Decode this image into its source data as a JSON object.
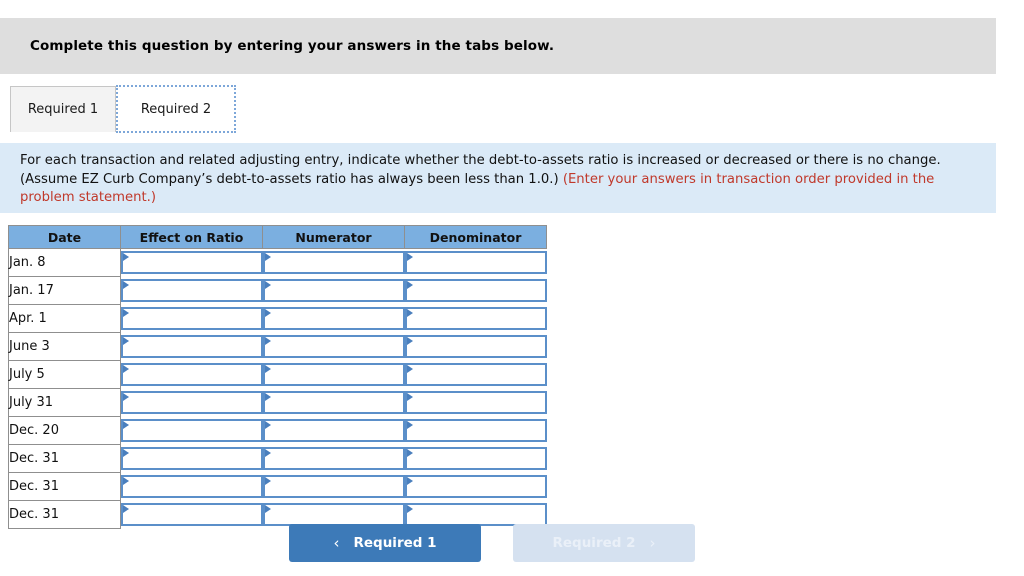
{
  "banner": {
    "text": "Complete this question by entering your answers in the tabs below."
  },
  "tabs": [
    {
      "label": "Required 1",
      "selected": false
    },
    {
      "label": "Required 2",
      "selected": true
    }
  ],
  "instructions": {
    "part1": "For each transaction and related adjusting entry, indicate whether the debt-to-assets ratio is increased or decreased or there is no change. (Assume EZ Curb Company’s debt-to-assets ratio has always been less than 1.0.) ",
    "part2": "(Enter your answers in transaction order provided in the problem statement.)"
  },
  "table": {
    "headers": [
      "Date",
      "Effect on Ratio",
      "Numerator",
      "Denominator"
    ],
    "rows": [
      {
        "date": "Jan. 8",
        "effect": "",
        "numerator": "",
        "denominator": ""
      },
      {
        "date": "Jan. 17",
        "effect": "",
        "numerator": "",
        "denominator": ""
      },
      {
        "date": "Apr. 1",
        "effect": "",
        "numerator": "",
        "denominator": ""
      },
      {
        "date": "June 3",
        "effect": "",
        "numerator": "",
        "denominator": ""
      },
      {
        "date": "July 5",
        "effect": "",
        "numerator": "",
        "denominator": ""
      },
      {
        "date": "July 31",
        "effect": "",
        "numerator": "",
        "denominator": ""
      },
      {
        "date": "Dec. 20",
        "effect": "",
        "numerator": "",
        "denominator": ""
      },
      {
        "date": "Dec. 31",
        "effect": "",
        "numerator": "",
        "denominator": ""
      },
      {
        "date": "Dec. 31",
        "effect": "",
        "numerator": "",
        "denominator": ""
      },
      {
        "date": "Dec. 31",
        "effect": "",
        "numerator": "",
        "denominator": ""
      }
    ]
  },
  "nav": {
    "prev_label": "Required 1",
    "prev_chevron": "‹",
    "next_label": "Required 2",
    "next_chevron": "›",
    "next_disabled": true
  },
  "colors": {
    "banner_bg": "#dedede",
    "instructions_bg": "#dbeaf7",
    "header_blue": "#7bafe0",
    "cell_border_blue": "#5b8fc9",
    "button_active": "#3d7ab8",
    "button_disabled": "#d5e1f0",
    "red_text": "#c0392b"
  }
}
